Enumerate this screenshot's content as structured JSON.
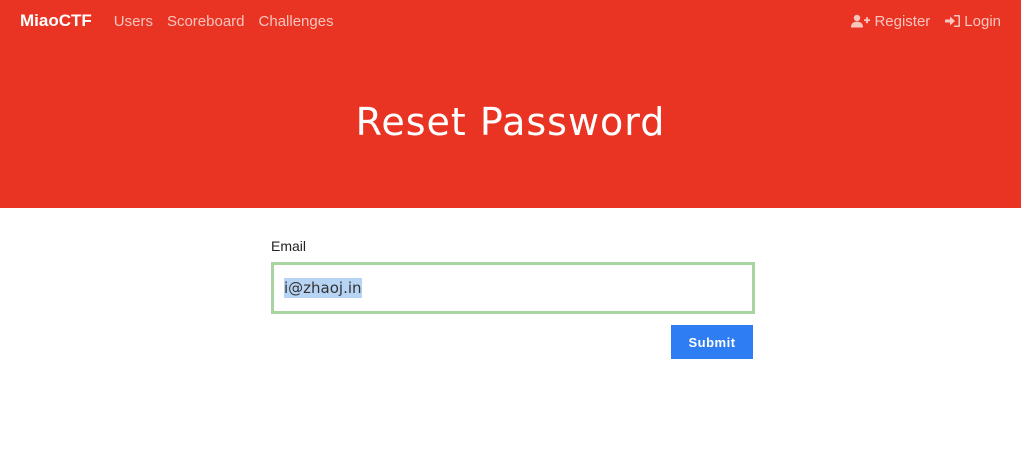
{
  "nav": {
    "brand": "MiaoCTF",
    "links": [
      "Users",
      "Scoreboard",
      "Challenges"
    ],
    "register_label": "Register",
    "login_label": "Login"
  },
  "hero": {
    "title": "Reset Password"
  },
  "form": {
    "email_label": "Email",
    "email_value": "i@zhaoj.in",
    "submit_label": "Submit"
  },
  "colors": {
    "brand_red": "#ea3423",
    "input_border_focus": "#a8d4a0",
    "submit_blue": "#2e7df2",
    "selection": "#b8d4f5"
  },
  "icons": {
    "register": "user-plus-icon",
    "login": "sign-in-icon"
  }
}
